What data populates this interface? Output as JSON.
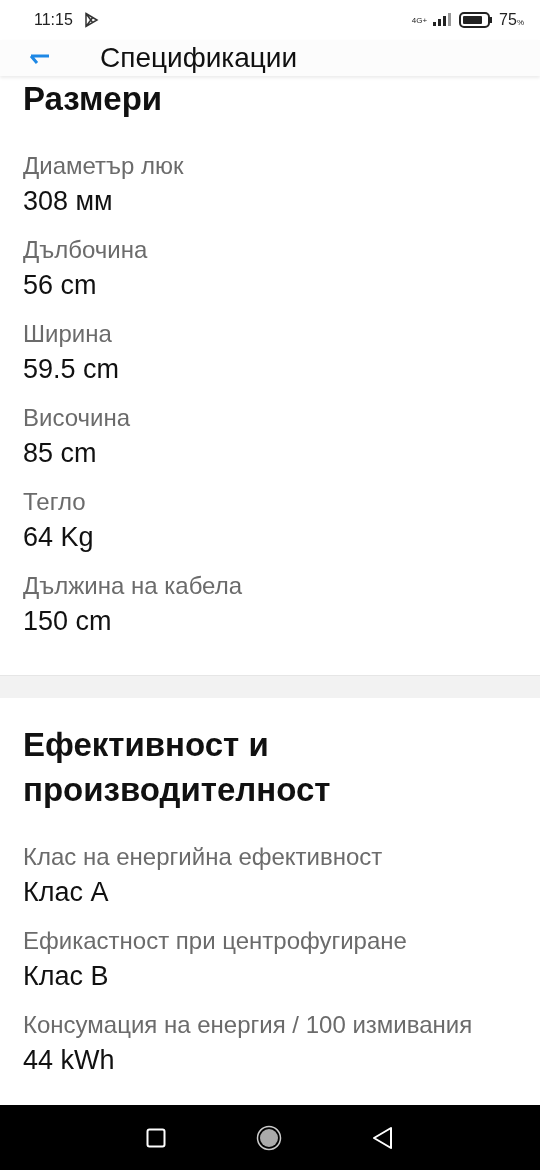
{
  "status_bar": {
    "time": "11:15",
    "network": "4G+",
    "battery": "75",
    "battery_unit": "%"
  },
  "header": {
    "title": "Спецификации"
  },
  "sections": [
    {
      "title": "Размери",
      "specs": [
        {
          "label": "Диаметър люк",
          "value": "308 мм"
        },
        {
          "label": "Дълбочина",
          "value": "56 cm"
        },
        {
          "label": "Ширина",
          "value": "59.5 cm"
        },
        {
          "label": "Височина",
          "value": "85 cm"
        },
        {
          "label": "Тегло",
          "value": "64 Kg"
        },
        {
          "label": "Дължина на кабела",
          "value": "150 cm"
        }
      ]
    },
    {
      "title": "Ефективност и производителност",
      "specs": [
        {
          "label": "Клас на енергийна ефективност",
          "value": "Клас A"
        },
        {
          "label": "Ефикастност при центрофугиране",
          "value": "Клас B"
        },
        {
          "label": "Консумация на енергия / 100 измивания",
          "value": "44 kWh"
        }
      ]
    }
  ]
}
